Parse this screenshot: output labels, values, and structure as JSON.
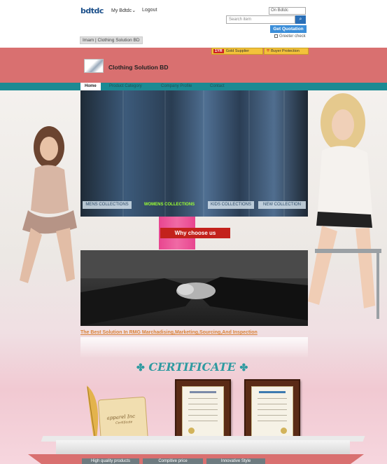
{
  "site": {
    "logo_text": "bdtdc",
    "my_account": "My Bdtdc",
    "my_account_caret": "⌄",
    "logout": "Logout"
  },
  "search": {
    "scope": "On Bdtdc",
    "placeholder": "Search item",
    "button_icon": "search-icon",
    "quote_button": "Get Quotation",
    "greeter_label": "Greeter check"
  },
  "breadcrumb": "Imam | Clothing Solution BD",
  "badges": {
    "supplier_years": "1YR",
    "supplier": "Gold Supplier",
    "buyer": "Buyer Protection"
  },
  "shop": {
    "name": "Clothing Solution BD"
  },
  "nav": {
    "items": [
      {
        "label": "Home",
        "active": true
      },
      {
        "label": "Product Category",
        "active": false
      },
      {
        "label": "Company Profile",
        "active": false
      },
      {
        "label": "Contact",
        "active": false
      }
    ]
  },
  "collections": [
    {
      "label": "MENS COLLECTIONS"
    },
    {
      "label": "WOMENS COLLECTIONS"
    },
    {
      "label": "KIDS COLLECTIONS"
    },
    {
      "label": "NEW COLLECTION"
    }
  ],
  "why_button": "Why choose us",
  "tagline": "The Best Solution In RMG Marchadising,Marketing,Sourcing,And Inspection",
  "certificate": {
    "title": "CERTIFICATE",
    "ornament": "✤",
    "scroll_title": "apparel Inc",
    "scroll_subtitle": "Certificate"
  },
  "features": [
    {
      "label": "High quality products"
    },
    {
      "label": "Compitive price"
    },
    {
      "label": "Innovative Style"
    }
  ],
  "colors": {
    "header_red": "#d97070",
    "nav_teal": "#1c8a93",
    "why_red": "#c3221c",
    "cert_teal": "#2e9aa0",
    "women_green": "#9bff33"
  }
}
